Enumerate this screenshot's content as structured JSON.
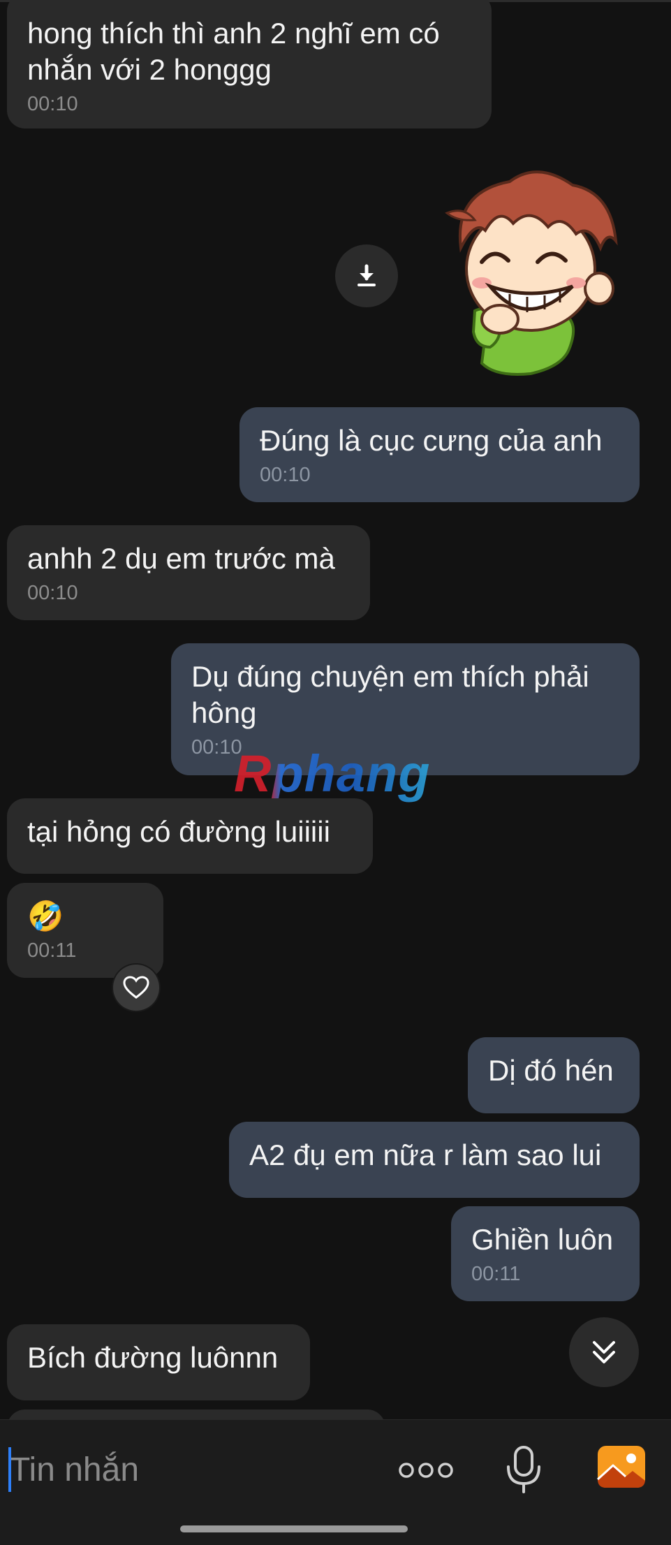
{
  "messages": [
    {
      "text": "hong thích thì anh 2 nghĩ em có\nnhắn với 2 honggg",
      "time": "00:10"
    },
    {
      "text": "Đúng là cục cưng của anh",
      "time": "00:10"
    },
    {
      "text": "anhh 2 dụ em trước mà",
      "time": "00:10"
    },
    {
      "text": "Dụ đúng chuyện em thích phải\nhông",
      "time": "00:10"
    },
    {
      "text": "tại hỏng có đường luiiiii"
    },
    {
      "text": "🤣",
      "time": "00:11"
    },
    {
      "text": "Dị đó hén"
    },
    {
      "text": "A2 đụ em nữa r làm sao lui"
    },
    {
      "text": "Ghiền luôn",
      "time": "00:11"
    },
    {
      "text": "Bích đường luônnn"
    }
  ],
  "watermark": "Rphang",
  "composer": {
    "placeholder": "Tin nhắn"
  },
  "icons": {
    "download": "download-icon",
    "react": "heart-icon",
    "scroll": "chevron-double-down-icon",
    "more": "more-dots-icon",
    "mic": "microphone-icon",
    "image": "image-icon"
  },
  "colors": {
    "background": "#121212",
    "incoming_bubble": "#2a2a2a",
    "outgoing_bubble": "#3a4352",
    "accent_orange": "#f79a1e",
    "cursor_blue": "#2d7ff9"
  }
}
